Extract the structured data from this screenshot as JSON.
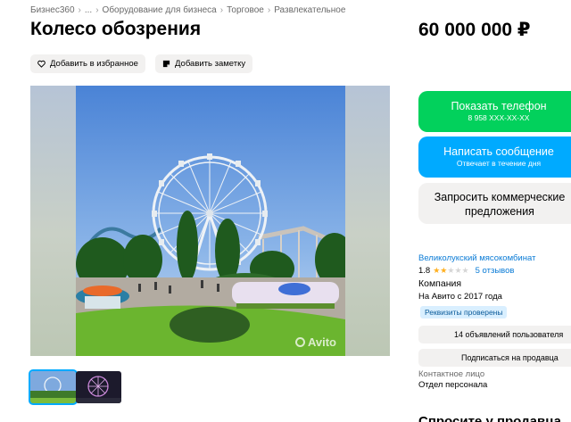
{
  "breadcrumb": [
    "Бизнес360",
    "...",
    "Оборудование для бизнеса",
    "Торговое",
    "Развлекательное"
  ],
  "breadcrumb_sep": "›",
  "listing": {
    "title": "Колесо обозрения",
    "price": "60 000 000 ₽"
  },
  "actions": {
    "favorite_label": "Добавить в избранное",
    "note_label": "Добавить заметку"
  },
  "gallery": {
    "watermark": "Avito",
    "thumbnail_count": 2
  },
  "contact_buttons": {
    "phone_label": "Показать телефон",
    "phone_number": "8 958 XXX-XX-XX",
    "message_label": "Написать сообщение",
    "message_sub": "Отвечает в течение дня",
    "offer_label": "Запросить коммерческие предложения"
  },
  "seller": {
    "name": "Великолукский мясокомбинат",
    "rating": "1.8",
    "stars_filled": 2,
    "stars_total": 5,
    "reviews": "5 отзывов",
    "type": "Компания",
    "since": "На Авито с 2017 года",
    "verified_badge": "Реквизиты проверены",
    "listings_button": "14 объявлений пользователя",
    "subscribe_button": "Подписаться на продавца",
    "contact_label": "Контактное лицо",
    "contact_name": "Отдел персонала"
  },
  "cut_heading": "Спросите у продавца",
  "colors": {
    "phone_button": "#02d15c",
    "message_button": "#00aaff",
    "link": "#0a7bd6",
    "star": "#ffb021"
  }
}
